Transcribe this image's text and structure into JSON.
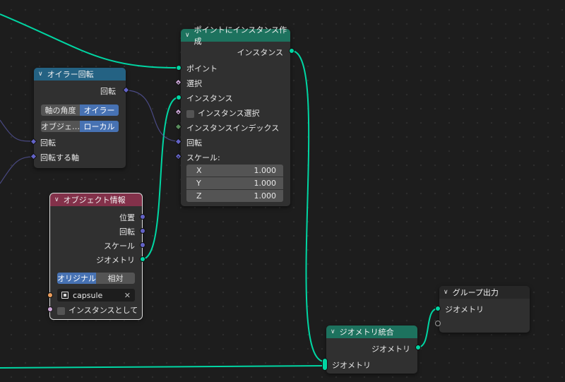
{
  "nodes": {
    "euler": {
      "title": "オイラー回転",
      "output_rotation": "回転",
      "mode_label": "軸の角度",
      "mode_value": "オイラー",
      "space_label": "オブジェ…",
      "space_value": "ローカル",
      "input_rotation": "回転",
      "input_axis": "回転する軸"
    },
    "instance_on_points": {
      "title": "ポイントにインスタンス作成",
      "output_instances": "インスタンス",
      "input_points": "ポイント",
      "input_selection": "選択",
      "input_instance": "インスタンス",
      "input_pick_instance": "インスタンス選択",
      "input_instance_index": "インスタンスインデックス",
      "input_rotation": "回転",
      "input_scale": "スケール:",
      "scale": [
        {
          "axis": "X",
          "value": "1.000"
        },
        {
          "axis": "Y",
          "value": "1.000"
        },
        {
          "axis": "Z",
          "value": "1.000"
        }
      ]
    },
    "object_info": {
      "title": "オブジェクト情報",
      "output_location": "位置",
      "output_rotation": "回転",
      "output_scale": "スケール",
      "output_geometry": "ジオメトリ",
      "transform_original": "オリジナル",
      "transform_relative": "相対",
      "object_name": "capsule",
      "clear_symbol": "✕",
      "as_instance": "インスタンスとして"
    },
    "join_geometry": {
      "title": "ジオメトリ統合",
      "output_geometry": "ジオメトリ",
      "input_geometry": "ジオメトリ"
    },
    "group_output": {
      "title": "グループ出力",
      "input_geometry": "ジオメトリ"
    }
  },
  "colors": {
    "geometry_socket": "#00d6a3",
    "vector_socket": "#6363c7",
    "header_euler": "#246283",
    "header_instance": "#1d725e",
    "header_object": "#83314a",
    "header_join": "#1d725e",
    "header_output": "#272727"
  }
}
